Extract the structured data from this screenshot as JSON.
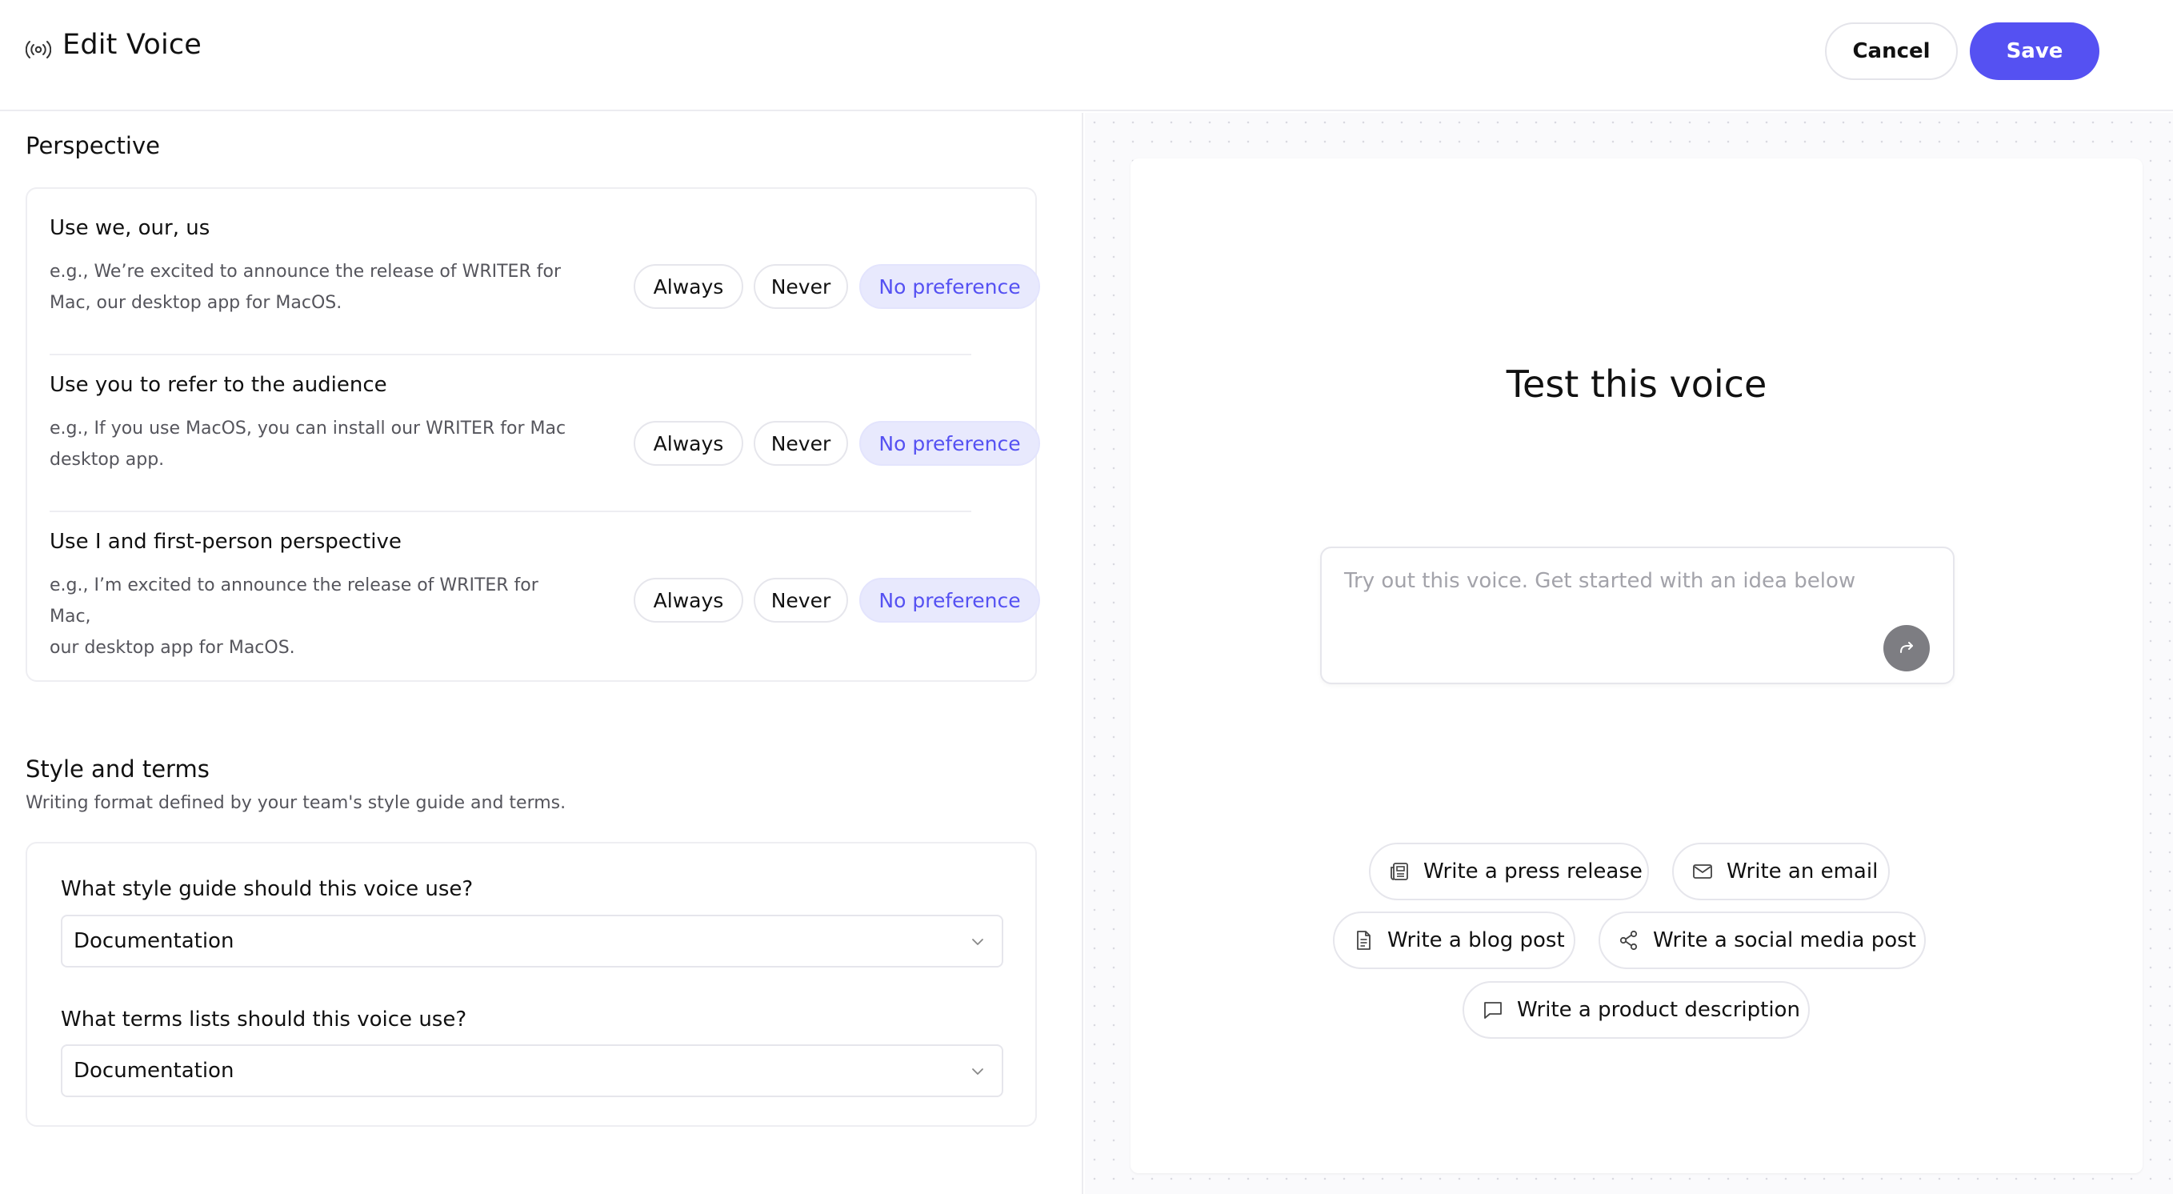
{
  "header": {
    "title": "Edit Voice",
    "cancel_label": "Cancel",
    "save_label": "Save"
  },
  "perspective": {
    "title": "Perspective",
    "options": {
      "always": "Always",
      "never": "Never",
      "no_preference": "No preference"
    },
    "rows": [
      {
        "title": "Use we, our, us",
        "example_line1": "e.g., We’re excited to announce the release of WRITER for",
        "example_line2": "Mac, our desktop app for MacOS.",
        "selected": "No preference"
      },
      {
        "title": "Use you to refer to the audience",
        "example_line1": "e.g., If you use MacOS, you can install our WRITER for Mac",
        "example_line2": "desktop app.",
        "selected": "No preference"
      },
      {
        "title": "Use I and first-person perspective",
        "example_line1": "e.g., I’m excited to announce the release of WRITER for Mac,",
        "example_line2": "our desktop app for MacOS.",
        "selected": "No preference"
      }
    ]
  },
  "style_terms": {
    "title": "Style and terms",
    "subtitle": "Writing format defined by your team's style guide and terms.",
    "style_guide_label": "What style guide should this voice use?",
    "style_guide_value": "Documentation",
    "terms_label": "What terms lists should this voice use?",
    "terms_value": "Documentation"
  },
  "test": {
    "title": "Test this voice",
    "placeholder": "Try out this voice. Get started with an idea below",
    "suggestions": [
      {
        "label": "Write a press release",
        "icon": "newspaper-icon"
      },
      {
        "label": "Write an email",
        "icon": "mail-icon"
      },
      {
        "label": "Write a blog post",
        "icon": "document-icon"
      },
      {
        "label": "Write a social media post",
        "icon": "share-icon"
      },
      {
        "label": "Write a product description",
        "icon": "message-icon"
      }
    ]
  },
  "colors": {
    "accent": "#5551f2",
    "selected_pill_bg": "#e8e9fd",
    "send_button": "#7d7d82"
  }
}
